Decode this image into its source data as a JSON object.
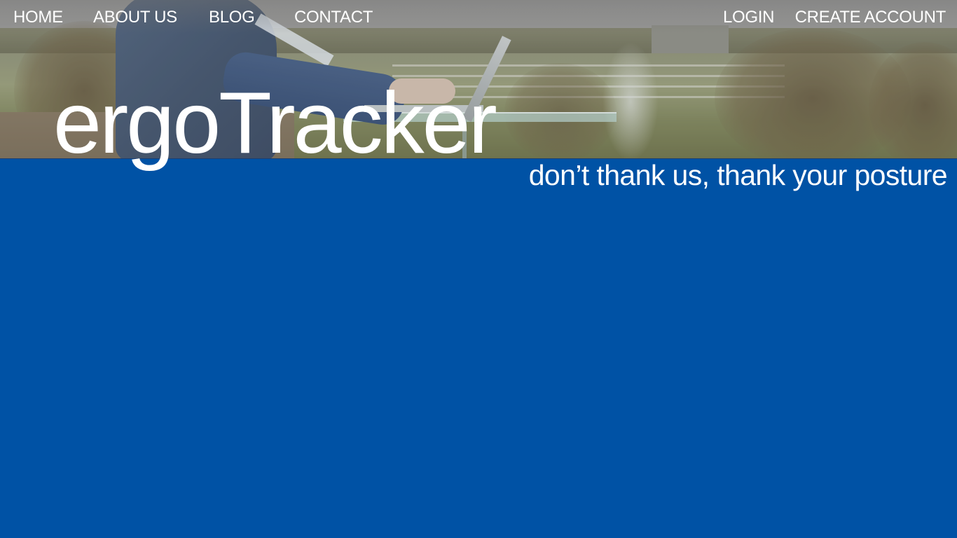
{
  "nav": {
    "left": [
      {
        "label": "HOME"
      },
      {
        "label": "ABOUT US"
      },
      {
        "label": "BLOG"
      },
      {
        "label": "CONTACT"
      }
    ],
    "right": [
      {
        "label": "LOGIN"
      },
      {
        "label": "CREATE ACCOUNT"
      }
    ]
  },
  "brand": {
    "name": "ergoTracker",
    "tagline": "don’t thank us, thank your posture"
  },
  "colors": {
    "primary_blue": "#0052a5",
    "text": "#ffffff"
  }
}
